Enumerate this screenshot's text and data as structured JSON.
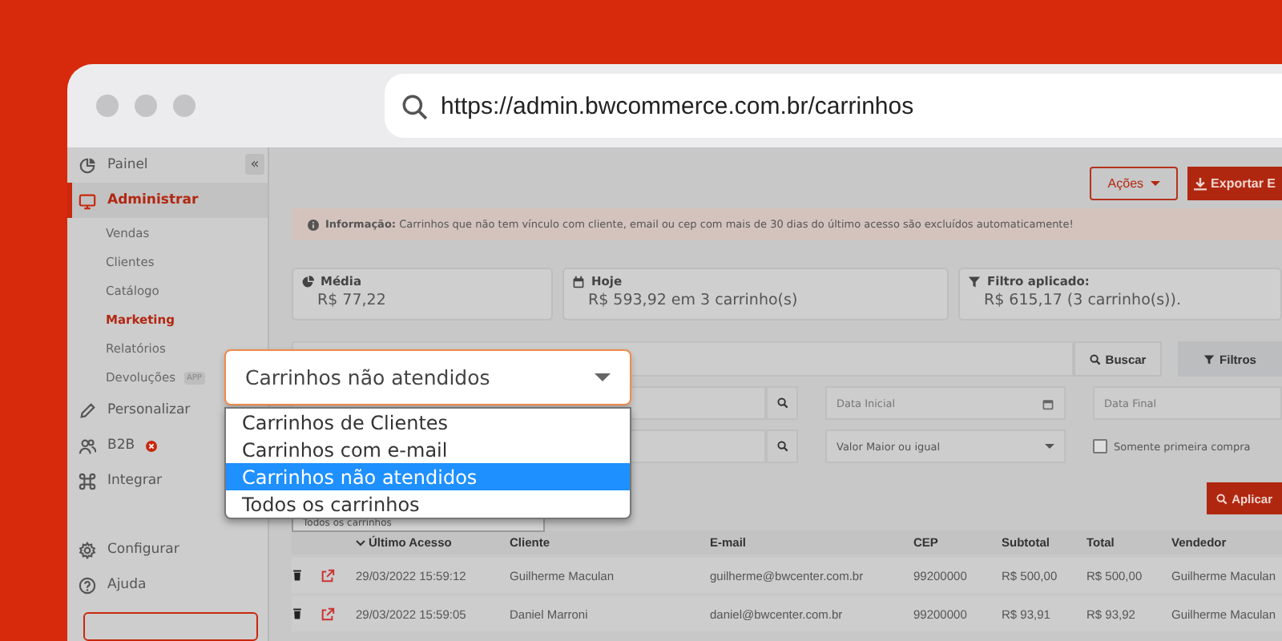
{
  "browser": {
    "url": "https://admin.bwcommerce.com.br/carrinhos"
  },
  "sidebar": {
    "items": [
      {
        "label": "Painel",
        "selected": false,
        "expanded": false,
        "notification": false
      },
      {
        "label": "Administrar",
        "selected": true,
        "expanded": true,
        "notification": false,
        "children": [
          {
            "label": "Vendas",
            "selected": false
          },
          {
            "label": "Clientes",
            "selected": false
          },
          {
            "label": "Catálogo",
            "selected": false
          },
          {
            "label": "Marketing",
            "selected": true
          },
          {
            "label": "Relatórios",
            "selected": false
          },
          {
            "label": "Devoluções",
            "selected": false,
            "badge": "APP"
          }
        ]
      },
      {
        "label": "Personalizar",
        "selected": false,
        "expanded": false,
        "notification": false
      },
      {
        "label": "B2B",
        "selected": false,
        "expanded": false,
        "notification": true
      },
      {
        "label": "Integrar",
        "selected": false,
        "expanded": false,
        "notification": false
      }
    ],
    "footer_items": [
      {
        "label": "Configurar",
        "selected": false
      },
      {
        "label": "Ajuda",
        "selected": false
      }
    ],
    "collapse": "«"
  },
  "toolbar": {
    "buttons": [
      {
        "label": "Ações",
        "kind": "dropdown"
      },
      {
        "label": "Exportar E",
        "kind": "primary"
      }
    ]
  },
  "info": "**Informação:** Carrinhos que não tem vínculo com cliente, email ou cep com mais de 30 dias do último acesso são excluídos automaticamente!",
  "stats": [
    {
      "label": "Média",
      "value": "R$ 77,22"
    },
    {
      "label": "Hoje",
      "value": "R$ 593,92 em 3 carrinho(s)"
    },
    {
      "label": "Filtro aplicado:",
      "value": "R$ 615,17 (3 carrinho(s))."
    }
  ],
  "search": {
    "button": "Buscar",
    "filters_button": "Filtros"
  },
  "filters": {
    "date_start": {
      "placeholder": "Data Inicial"
    },
    "date_end": {
      "placeholder": "Data Final"
    },
    "value_select": {
      "value": "Valor Maior ou igual"
    },
    "first_purchase": {
      "label": "Somente primeira compra",
      "checked": false
    },
    "apply": "Aplicar"
  },
  "cart_type_select": {
    "value": "Carrinhos não atendidos",
    "expanded": true,
    "options": [
      {
        "label": "Carrinhos de Clientes",
        "selected": false
      },
      {
        "label": "Carrinhos com e-mail",
        "selected": false
      },
      {
        "label": "Carrinhos não atendidos",
        "selected": true
      },
      {
        "label": "Todos os carrinhos",
        "selected": false
      }
    ],
    "hint": "Todos os carrinhos"
  },
  "table": {
    "columns": [
      {
        "label": "Último Acesso",
        "sorted": true
      },
      {
        "label": "Cliente",
        "sorted": false
      },
      {
        "label": "E-mail",
        "sorted": false
      },
      {
        "label": "CEP",
        "sorted": false
      },
      {
        "label": "Subtotal",
        "sorted": false
      },
      {
        "label": "Total",
        "sorted": false
      },
      {
        "label": "Vendedor",
        "sorted": false
      }
    ],
    "rows": [
      {
        "cells": [
          "29/03/2022 15:59:12",
          "Guilherme Maculan",
          "guilherme@bwcenter.com.br",
          "99200000",
          "R$ 500,00",
          "R$ 500,00",
          "Guilherme Maculan"
        ]
      },
      {
        "cells": [
          "29/03/2022 15:59:05",
          "Daniel Marroni",
          "daniel@bwcenter.com.br",
          "99200000",
          "R$ 93,91",
          "R$ 93,92",
          "Guilherme Maculan"
        ]
      }
    ]
  }
}
